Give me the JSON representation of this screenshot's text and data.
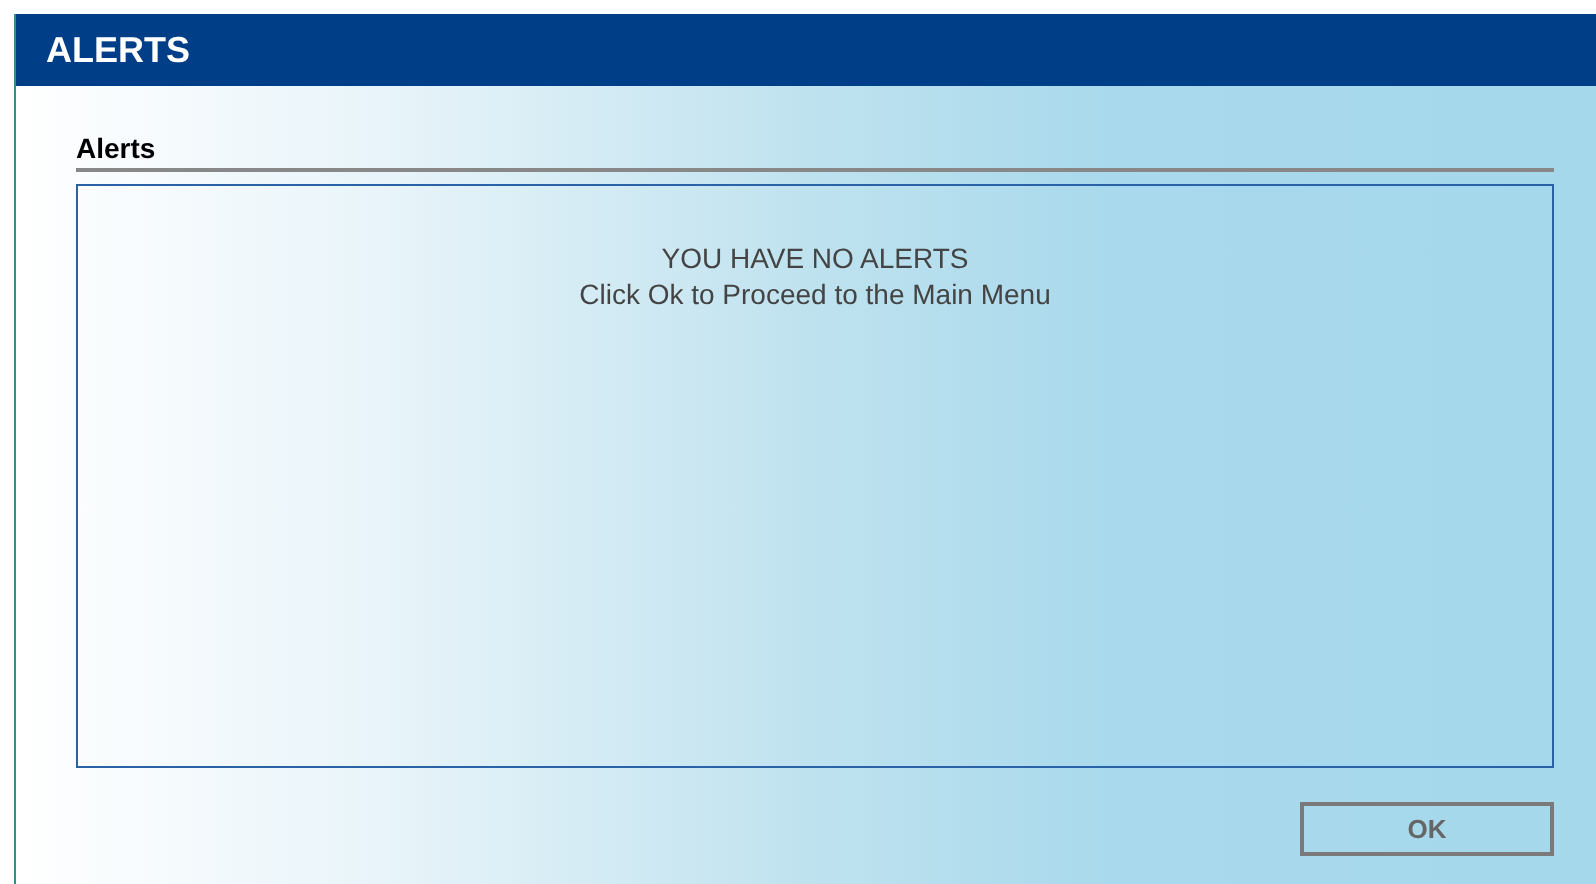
{
  "window": {
    "title": "ALERTS"
  },
  "section": {
    "title": "Alerts"
  },
  "messages": [
    "YOU HAVE NO ALERTS",
    "Click Ok to Proceed to the Main Menu"
  ],
  "buttons": [
    "OK"
  ]
}
